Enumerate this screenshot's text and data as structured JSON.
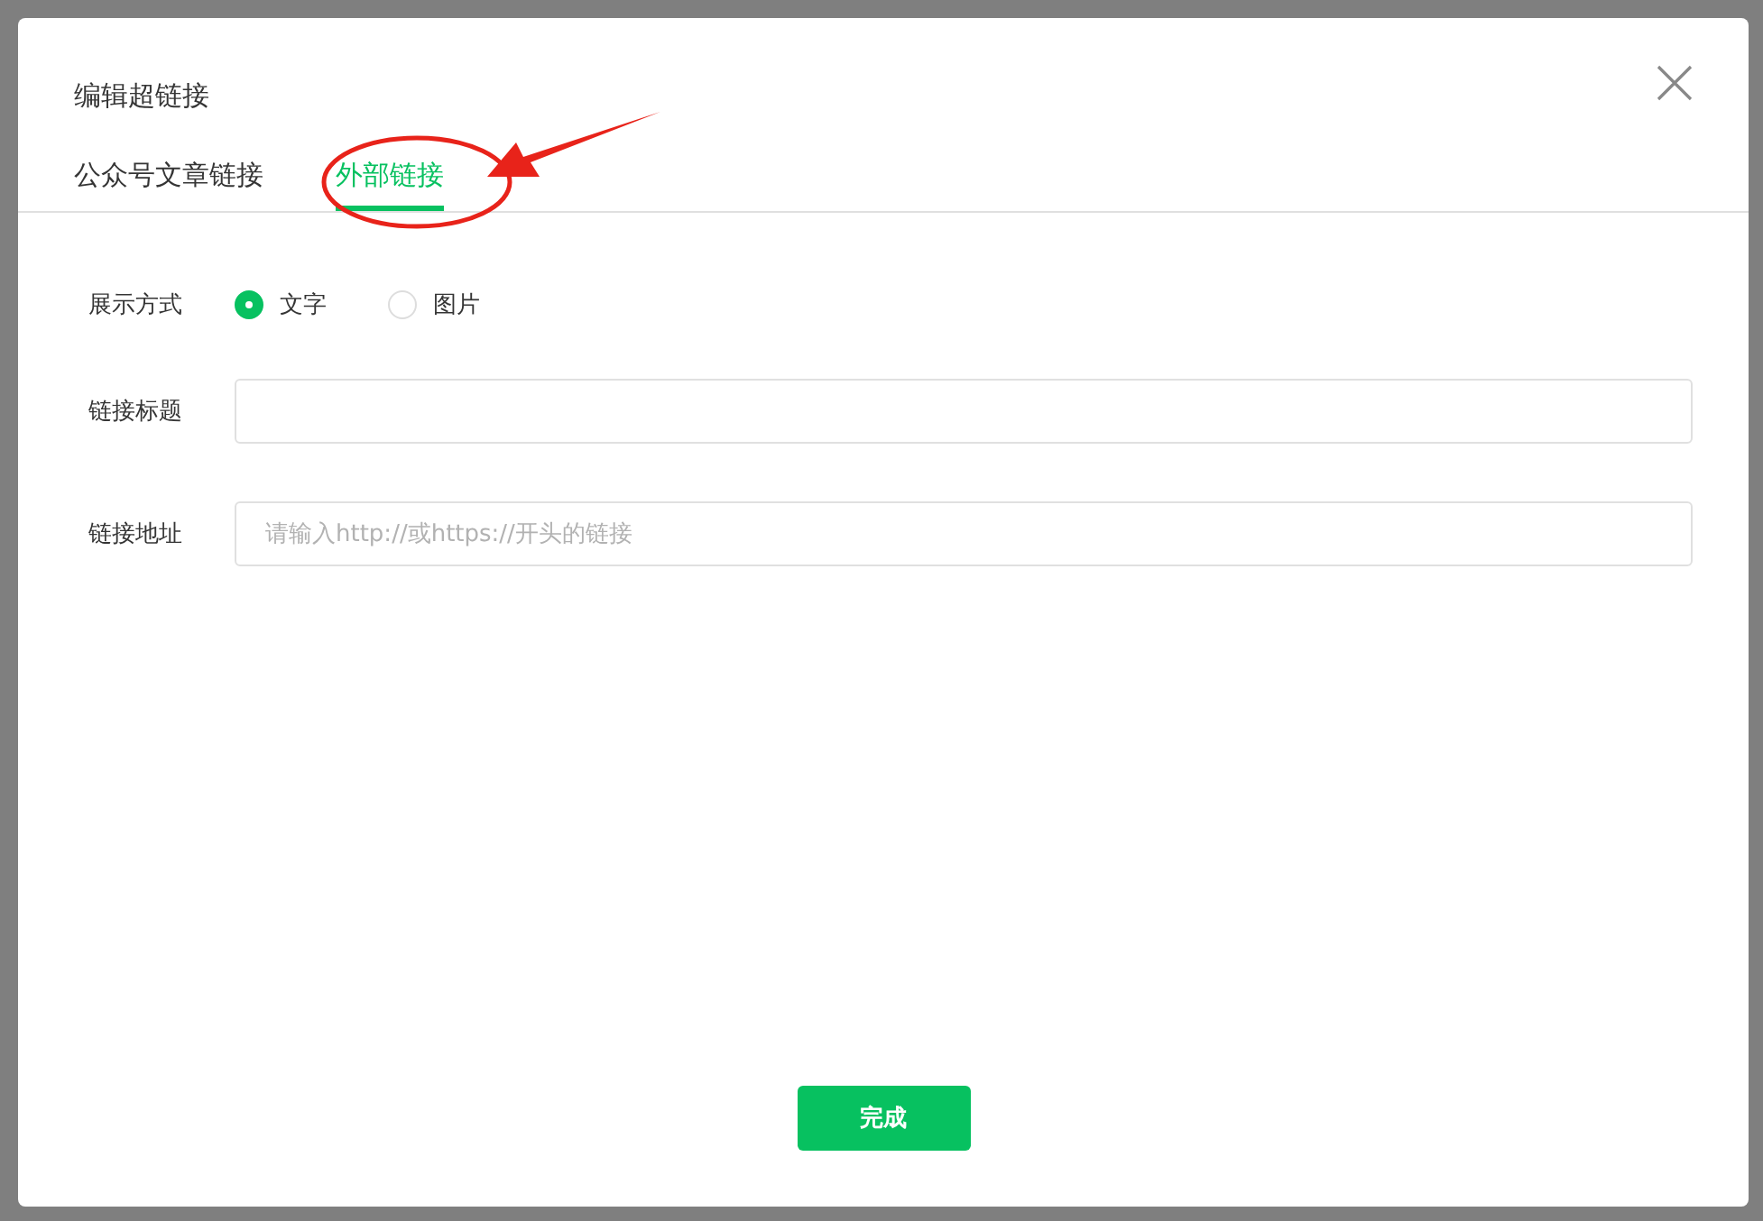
{
  "dialog": {
    "title": "编辑超链接"
  },
  "tabs": [
    {
      "label": "公众号文章链接",
      "selected": false
    },
    {
      "label": "外部链接",
      "selected": true
    }
  ],
  "form": [
    {
      "kind": "radio",
      "label": "展示方式",
      "options": [
        {
          "label": "文字",
          "selected": true
        },
        {
          "label": "图片",
          "selected": false
        }
      ]
    },
    {
      "kind": "input",
      "label": "链接标题"
    },
    {
      "kind": "input",
      "label": "链接地址",
      "placeholder": "请输入http://或https://开头的链接"
    }
  ],
  "buttons": [
    "完成"
  ]
}
